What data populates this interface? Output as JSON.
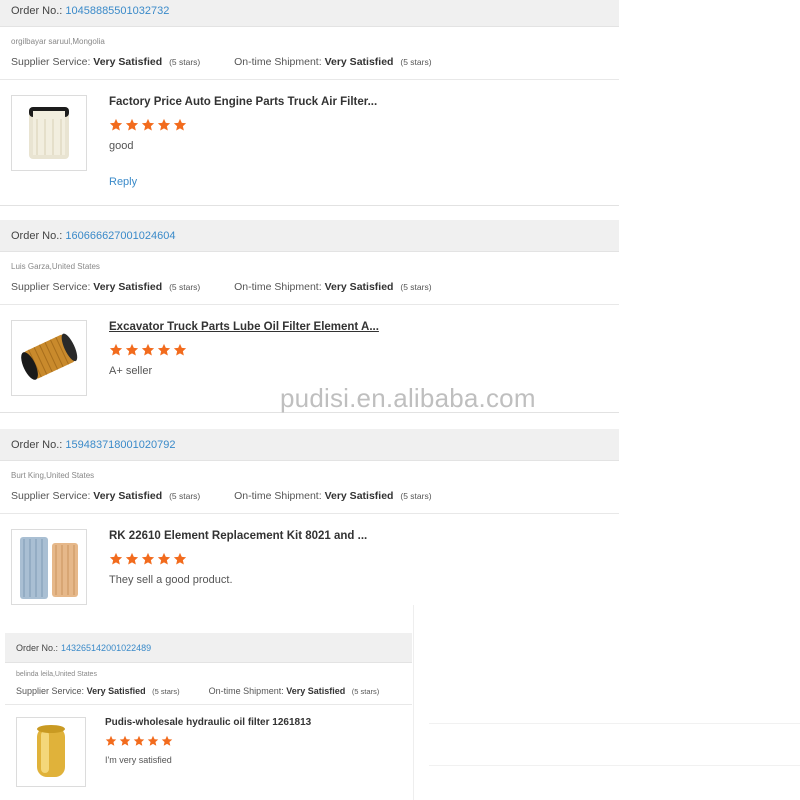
{
  "reviews": [
    {
      "order_label": "Order No.:",
      "order_number": "10458885501032732",
      "buyer": "orgilbayar saruul,Mongolia",
      "supplier_service_label": "Supplier Service:",
      "supplier_service_value": "Very Satisfied",
      "supplier_stars": "(5 stars)",
      "shipment_label": "On-time Shipment:",
      "shipment_value": "Very Satisfied",
      "shipment_stars": "(5 stars)",
      "product_title": "Factory Price Auto Engine Parts Truck Air Filter...",
      "rating": 5,
      "comment": "good",
      "reply": "Reply",
      "thumb_icon": "air-filter-image"
    },
    {
      "order_label": "Order No.:",
      "order_number": "160666627001024604",
      "buyer": "Luis Garza,United States",
      "supplier_service_label": "Supplier Service:",
      "supplier_service_value": "Very Satisfied",
      "supplier_stars": "(5 stars)",
      "shipment_label": "On-time Shipment:",
      "shipment_value": "Very Satisfied",
      "shipment_stars": "(5 stars)",
      "product_title": "Excavator Truck Parts Lube Oil Filter Element A...",
      "rating": 5,
      "comment": "A+ seller",
      "thumb_icon": "oil-filter-image"
    },
    {
      "order_label": "Order No.:",
      "order_number": "159483718001020792",
      "buyer": "Burt King,United States",
      "supplier_service_label": "Supplier Service:",
      "supplier_service_value": "Very Satisfied",
      "supplier_stars": "(5 stars)",
      "shipment_label": "On-time Shipment:",
      "shipment_value": "Very Satisfied",
      "shipment_stars": "(5 stars)",
      "product_title": "RK 22610 Element Replacement Kit 8021 and ...",
      "rating": 5,
      "comment": "They sell a good product.",
      "thumb_icon": "filter-kit-image"
    },
    {
      "order_label": "Order No.:",
      "order_number": "143265142001022489",
      "buyer": "belinda leila,United States",
      "supplier_service_label": "Supplier Service:",
      "supplier_service_value": "Very Satisfied",
      "supplier_stars": "(5 stars)",
      "shipment_label": "On-time Shipment:",
      "shipment_value": "Very Satisfied",
      "shipment_stars": "(5 stars)",
      "product_title": "Pudis-wholesale hydraulic oil filter 1261813",
      "rating": 5,
      "comment": "I'm very satisfied",
      "thumb_icon": "hydraulic-filter-image"
    }
  ],
  "watermark": "pudisi.en.alibaba.com",
  "colors": {
    "star": "#f26b1d",
    "link": "#3a8ac9",
    "bar": "#f0f0f0"
  }
}
